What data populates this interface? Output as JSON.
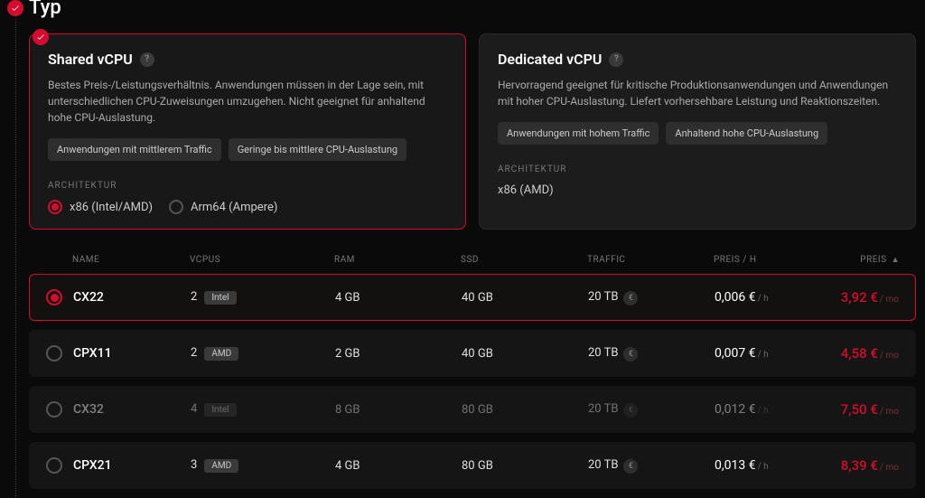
{
  "section_title": "Typ",
  "cards": {
    "shared": {
      "title": "Shared vCPU",
      "desc": "Bestes Preis-/Leistungsverhältnis. Anwendungen müssen in der Lage sein, mit unterschiedlichen CPU-Zuweisungen umzugehen. Nicht geeignet für anhaltend hohe CPU-Auslastung.",
      "tags": [
        "Anwendungen mit mittlerem Traffic",
        "Geringe bis mittlere CPU-Auslastung"
      ],
      "arch_label": "ARCHITEKTUR",
      "arch_options": [
        {
          "label": "x86 (Intel/AMD)",
          "checked": true
        },
        {
          "label": "Arm64 (Ampere)",
          "checked": false
        }
      ]
    },
    "dedicated": {
      "title": "Dedicated vCPU",
      "desc": "Hervorragend geeignet für kritische Produktionsanwendungen und Anwendungen mit hoher CPU-Auslastung. Liefert vorhersehbare Leistung und Reaktionszeiten.",
      "tags": [
        "Anwendungen mit hohem Traffic",
        "Anhaltend hohe CPU-Auslastung"
      ],
      "arch_label": "ARCHITEKTUR",
      "arch_text": "x86 (AMD)"
    }
  },
  "table": {
    "headers": {
      "name": "NAME",
      "vcpus": "VCPUS",
      "ram": "RAM",
      "ssd": "SSD",
      "traffic": "TRAFFIC",
      "priceh": "PREIS / H",
      "price": "PREIS"
    },
    "rows": [
      {
        "selected": true,
        "faded": false,
        "name": "CX22",
        "vcpus": "2",
        "cpu": "Intel",
        "ram": "4 GB",
        "ssd": "40 GB",
        "traffic": "20 TB",
        "priceh": "0,006 €",
        "priceh_sub": "/ h",
        "price": "3,92 €",
        "price_sub": "/ mo"
      },
      {
        "selected": false,
        "faded": false,
        "name": "CPX11",
        "vcpus": "2",
        "cpu": "AMD",
        "ram": "2 GB",
        "ssd": "40 GB",
        "traffic": "20 TB",
        "priceh": "0,007 €",
        "priceh_sub": "/ h",
        "price": "4,58 €",
        "price_sub": "/ mo"
      },
      {
        "selected": false,
        "faded": true,
        "name": "CX32",
        "vcpus": "4",
        "cpu": "Intel",
        "ram": "8 GB",
        "ssd": "80 GB",
        "traffic": "20 TB",
        "priceh": "0,012 €",
        "priceh_sub": "/ h",
        "price": "7,50 €",
        "price_sub": "/ mo"
      },
      {
        "selected": false,
        "faded": false,
        "name": "CPX21",
        "vcpus": "3",
        "cpu": "AMD",
        "ram": "4 GB",
        "ssd": "80 GB",
        "traffic": "20 TB",
        "priceh": "0,013 €",
        "priceh_sub": "/ h",
        "price": "8,39 €",
        "price_sub": "/ mo"
      }
    ]
  }
}
